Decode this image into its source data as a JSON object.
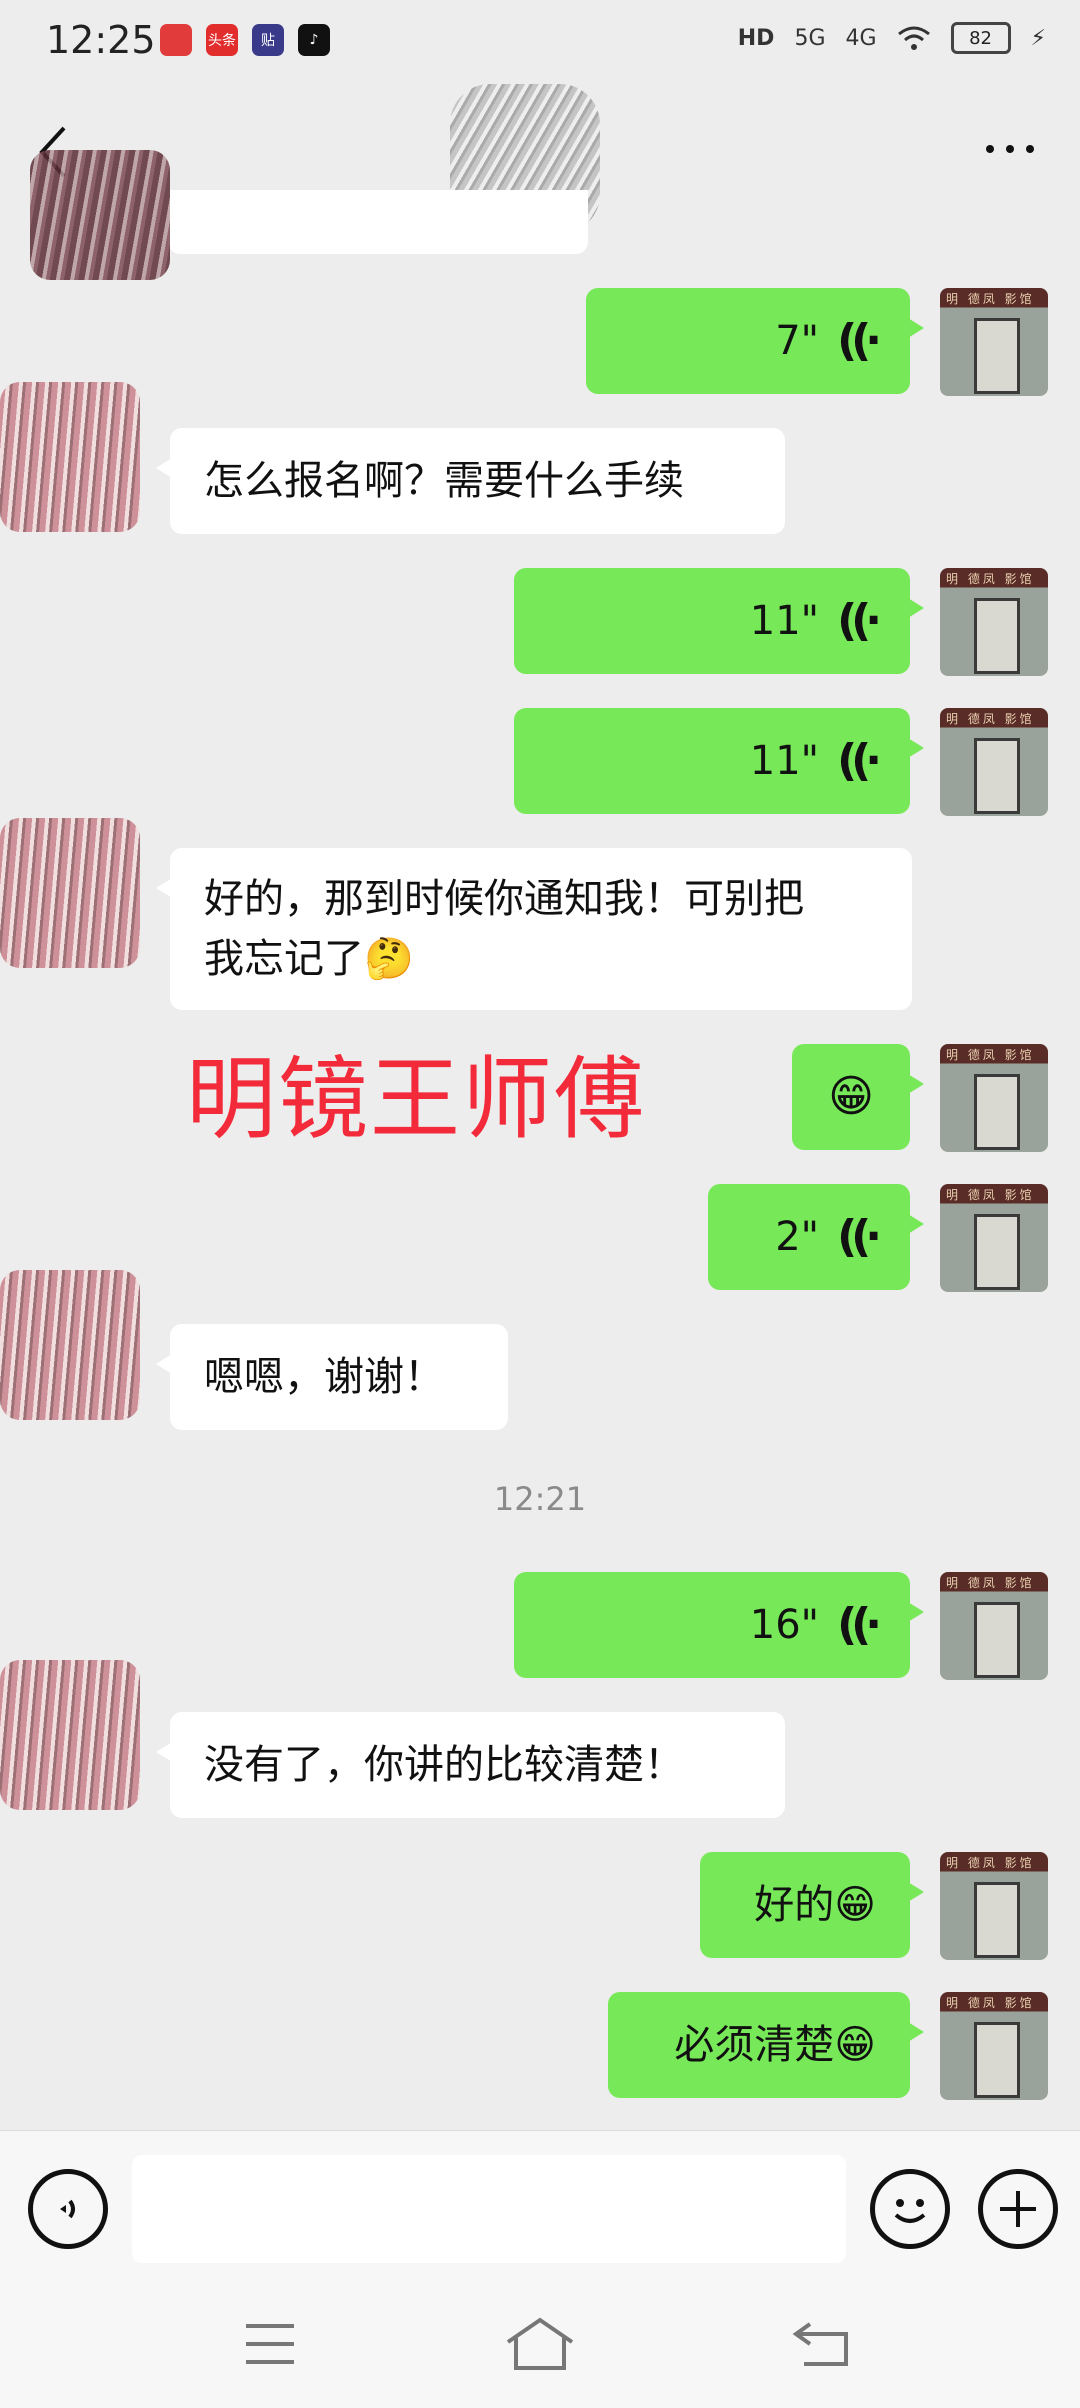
{
  "status_bar": {
    "time": "12:25",
    "network_1": "5G",
    "network_2": "4G",
    "hd_label": "HD",
    "battery": "82",
    "app_icon_labels": [
      "",
      "头条",
      "贴",
      ""
    ]
  },
  "header": {
    "back_icon": "chevron-left-icon",
    "more_icon": "more-dots-icon"
  },
  "messages": [
    {
      "type": "voice",
      "dir": "out",
      "duration": "7\""
    },
    {
      "type": "text",
      "dir": "in",
      "text": "怎么报名啊？需要什么手续"
    },
    {
      "type": "voice",
      "dir": "out",
      "duration": "11\""
    },
    {
      "type": "voice",
      "dir": "out",
      "duration": "11\""
    },
    {
      "type": "text",
      "dir": "in",
      "line1": "好的，那到时候你通知我！可别把",
      "line2": "我忘记了🤔"
    },
    {
      "type": "emoji",
      "dir": "out",
      "text": "😁"
    },
    {
      "type": "voice",
      "dir": "out",
      "duration": "2\""
    },
    {
      "type": "text",
      "dir": "in",
      "text": "嗯嗯，谢谢！"
    },
    {
      "type": "voice",
      "dir": "out",
      "duration": "16\""
    },
    {
      "type": "text",
      "dir": "in",
      "text": "没有了，你讲的比较清楚！"
    },
    {
      "type": "text",
      "dir": "out",
      "text": "好的😁"
    },
    {
      "type": "text",
      "dir": "out",
      "text": "必须清楚😁"
    }
  ],
  "timestamp": "12:21",
  "watermark": "明镜王师傅",
  "avatar_sign": "明 德凤 影馆",
  "voice_glyph": "((·",
  "input_bar": {
    "voice_icon": "voice-toggle-icon",
    "emoji_icon": "smiley-icon",
    "plus_icon": "plus-icon",
    "message_placeholder": ""
  },
  "nav_bar": {
    "menu_icon": "menu-icon",
    "home_icon": "home-icon",
    "back_icon": "back-arrow-icon"
  }
}
